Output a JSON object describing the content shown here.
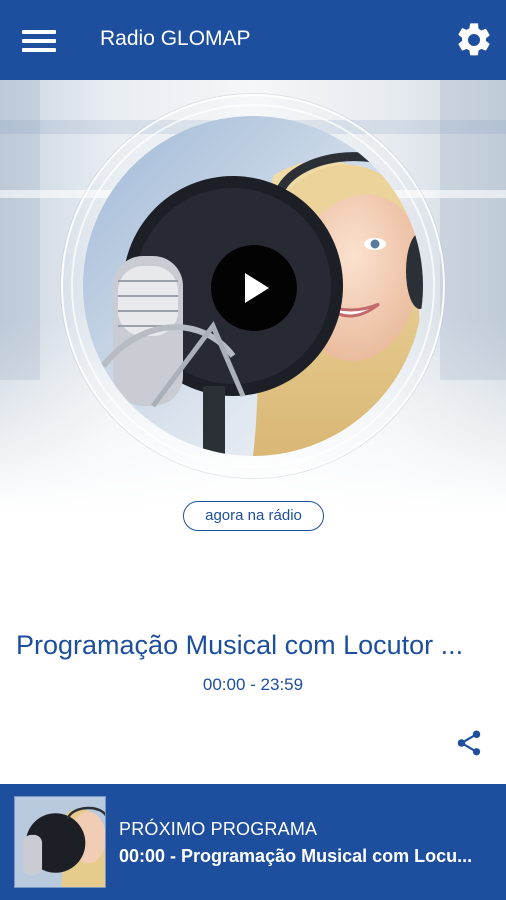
{
  "app": {
    "title": "Radio GLOMAP"
  },
  "icons": {
    "menu": "hamburger-menu-icon",
    "settings": "gear-icon",
    "play": "play-icon",
    "share": "share-icon"
  },
  "colors": {
    "brand": "#1d4f9e",
    "background": "#ffffff"
  },
  "now_playing": {
    "badge": "agora na rádio",
    "program": "Programação Musical com Locutor ...",
    "time": "00:00 - 23:59"
  },
  "next_program": {
    "label": "PRÓXIMO PROGRAMA",
    "title": "00:00 - Programação Musical com Locu..."
  }
}
